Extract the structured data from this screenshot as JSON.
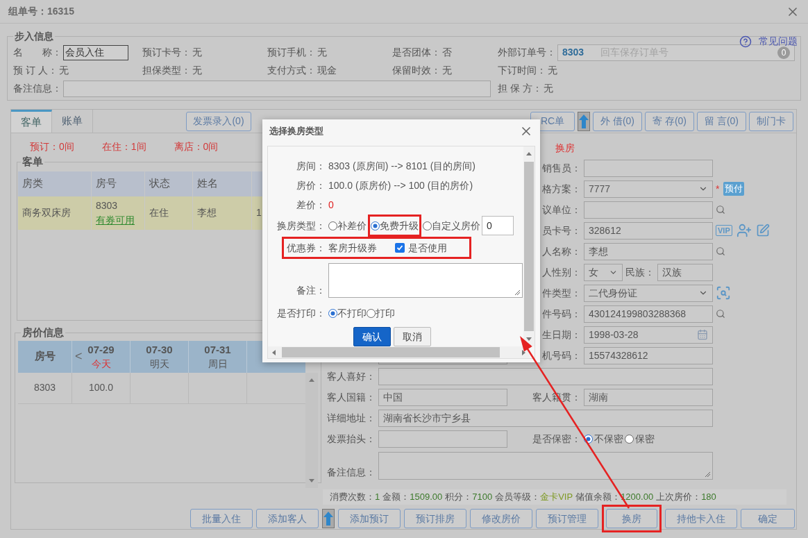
{
  "window": {
    "title": "组单号：16315"
  },
  "help_link": "常见问题",
  "step_info": {
    "legend": "步入信息",
    "rows": [
      [
        {
          "label": "名　　称：",
          "kind": "input",
          "value": "会员入住"
        },
        {
          "label": "预订卡号：",
          "kind": "text",
          "value": "无"
        },
        {
          "label": "预订手机：",
          "kind": "text",
          "value": "无"
        },
        {
          "label": "是否团体：",
          "kind": "text",
          "value": "否"
        },
        {
          "label": "外部订单号：",
          "kind": "order_input",
          "value": "8303",
          "placeholder": "回车保存订单号",
          "badge": "0"
        }
      ],
      [
        {
          "label": "预 订 人：",
          "kind": "text",
          "value": "无"
        },
        {
          "label": "担保类型：",
          "kind": "text",
          "value": "无"
        },
        {
          "label": "支付方式：",
          "kind": "text",
          "value": "现金"
        },
        {
          "label": "保留时效：",
          "kind": "text",
          "value": "无"
        },
        {
          "label": "下订时间：",
          "kind": "text",
          "value": "无"
        }
      ],
      [
        {
          "label": "备注信息：",
          "kind": "wide_input"
        },
        "",
        "",
        "",
        {
          "label": "担 保 方：",
          "kind": "text",
          "value": "无"
        }
      ]
    ]
  },
  "tabs": [
    {
      "label": "客单",
      "selected": true
    },
    {
      "label": "账单",
      "selected": false
    }
  ],
  "toolbar_left": [
    {
      "kind": "button",
      "label": "发票录入(0)"
    }
  ],
  "toolbar_right": [
    {
      "kind": "button",
      "label": "RC单"
    },
    {
      "kind": "icon"
    },
    {
      "kind": "button",
      "label": "外 借(0)"
    },
    {
      "kind": "button",
      "label": "寄 存(0)"
    },
    {
      "kind": "button",
      "label": "留 言(0)"
    },
    {
      "kind": "button",
      "label": "制门卡"
    }
  ],
  "counts": [
    "预订：0间",
    "在住：1间",
    "离店：0间"
  ],
  "guest_list": {
    "legend": "客单",
    "columns": [
      "房类",
      "房号",
      "状态",
      "姓名"
    ],
    "rows": [
      {
        "selected": true,
        "cells": [
          "商务双床房",
          "8303",
          "在住",
          "李想",
          "1"
        ],
        "coupon_link": "有券可用"
      }
    ]
  },
  "price_info": {
    "legend": "房价信息",
    "room_header": "房号",
    "prev": "<",
    "days": [
      {
        "date": "07-29",
        "day": "今天",
        "today": true
      },
      {
        "date": "07-30",
        "day": "明天",
        "today": false
      },
      {
        "date": "07-31",
        "day": "周日",
        "today": false
      }
    ],
    "rows": [
      {
        "room": "8303",
        "prices": [
          "100.0"
        ]
      }
    ]
  },
  "form": {
    "heading": "换房",
    "rows": [
      {
        "right": {
          "label": "销售员：",
          "kind": "input"
        }
      },
      {
        "right": {
          "label": "格方案：",
          "kind": "select",
          "value": "7777",
          "required": "*",
          "badge": "预付"
        }
      },
      {
        "right": {
          "label": "议单位：",
          "kind": "input"
        }
      },
      {
        "right": {
          "label": "员卡号：",
          "kind": "input",
          "value": "328612",
          "icon_text": "VIP"
        }
      },
      {
        "right": {
          "label": "人名称：",
          "kind": "input",
          "value": "李想"
        }
      },
      {
        "right": {
          "label": "人性别：",
          "kind": "gender",
          "value": "女",
          "label2": "民族：",
          "value2": "汉族"
        }
      },
      {
        "right": {
          "label": "件类型：",
          "kind": "select",
          "value": "二代身份证"
        }
      },
      {
        "right": {
          "label": "件号码：",
          "kind": "input",
          "value": "430124199803288368"
        }
      },
      {
        "right": {
          "label": "生日期：",
          "kind": "date",
          "value": "1998-03-28"
        }
      },
      {
        "left": {
          "kind": "input"
        },
        "right": {
          "label": "机号码：",
          "kind": "input",
          "value": "15574328612"
        }
      },
      {
        "wide": {
          "label": "客人喜好：",
          "kind": "input"
        }
      },
      {
        "left": {
          "label": "客人国籍：",
          "kind": "input",
          "value": "中国"
        },
        "right": {
          "label": "客人籍贯：",
          "kind": "input",
          "value": "湖南"
        }
      },
      {
        "wide": {
          "label": "详细地址：",
          "kind": "input",
          "value": "湖南省长沙市宁乡县"
        }
      },
      {
        "left": {
          "label": "发票抬头：",
          "kind": "input"
        },
        "right": {
          "label": "是否保密：",
          "kind": "radio",
          "options": [
            {
              "label": "不保密",
              "selected": true
            },
            {
              "label": "保密",
              "selected": false
            }
          ]
        }
      },
      {
        "wide": {
          "label": "备注信息：",
          "kind": "textarea"
        }
      }
    ]
  },
  "stats": [
    {
      "label": "消费次数：",
      "value": "1",
      "color": "#3d7a2c"
    },
    {
      "label": "金额：",
      "value": "1509.00",
      "color": "#3d7a2c"
    },
    {
      "label": "积分：",
      "value": "7100",
      "color": "#3d7a2c"
    },
    {
      "label": "会员等级：",
      "value": "金卡VIP",
      "color": "#7f9a25"
    },
    {
      "label": "储值余额：",
      "value": "1200.00",
      "color": "#3d7a2c"
    },
    {
      "label": "上次房价：",
      "value": "180",
      "color": "#3d7a2c"
    }
  ],
  "bottom_buttons": [
    {
      "kind": "button",
      "label": "批量入住"
    },
    {
      "kind": "button",
      "label": "添加客人"
    },
    {
      "kind": "icon"
    },
    {
      "kind": "button",
      "label": "添加预订"
    },
    {
      "kind": "button",
      "label": "预订排房"
    },
    {
      "kind": "button",
      "label": "修改房价"
    },
    {
      "kind": "button",
      "label": "预订管理"
    },
    {
      "kind": "button",
      "label": "换房",
      "annotated": true
    },
    {
      "kind": "button",
      "label": "持他卡入住"
    },
    {
      "kind": "button",
      "label": "确定"
    }
  ],
  "dialog": {
    "title": "选择换房类型",
    "rows": [
      {
        "label": "房间：",
        "value": "8303 (原房间) --> 8101 (目的房间)",
        "alert": false
      },
      {
        "label": "房价：",
        "value": "100.0 (原房价) --> 100 (目的房价)",
        "alert": false
      },
      {
        "label": "差价：",
        "value": "0",
        "alert": true
      }
    ],
    "change_type": {
      "label": "换房类型：",
      "options": [
        {
          "label": "补差价",
          "selected": false,
          "annotated": false
        },
        {
          "label": "免费升级",
          "selected": true,
          "annotated": true
        },
        {
          "label": "自定义房价",
          "selected": false,
          "annotated": false
        }
      ],
      "price": "0"
    },
    "coupon": {
      "label": "优惠券：",
      "name": "客房升级券",
      "use_label": "是否使用",
      "checked": true,
      "annotated": true
    },
    "note": {
      "label": "备注："
    },
    "print": {
      "label": "是否打印：",
      "options": [
        {
          "label": "不打印",
          "selected": true
        },
        {
          "label": "打印",
          "selected": false
        }
      ]
    },
    "buttons": [
      {
        "label": "确认",
        "kind": "primary"
      },
      {
        "label": "取消",
        "kind": "secondary"
      }
    ]
  }
}
